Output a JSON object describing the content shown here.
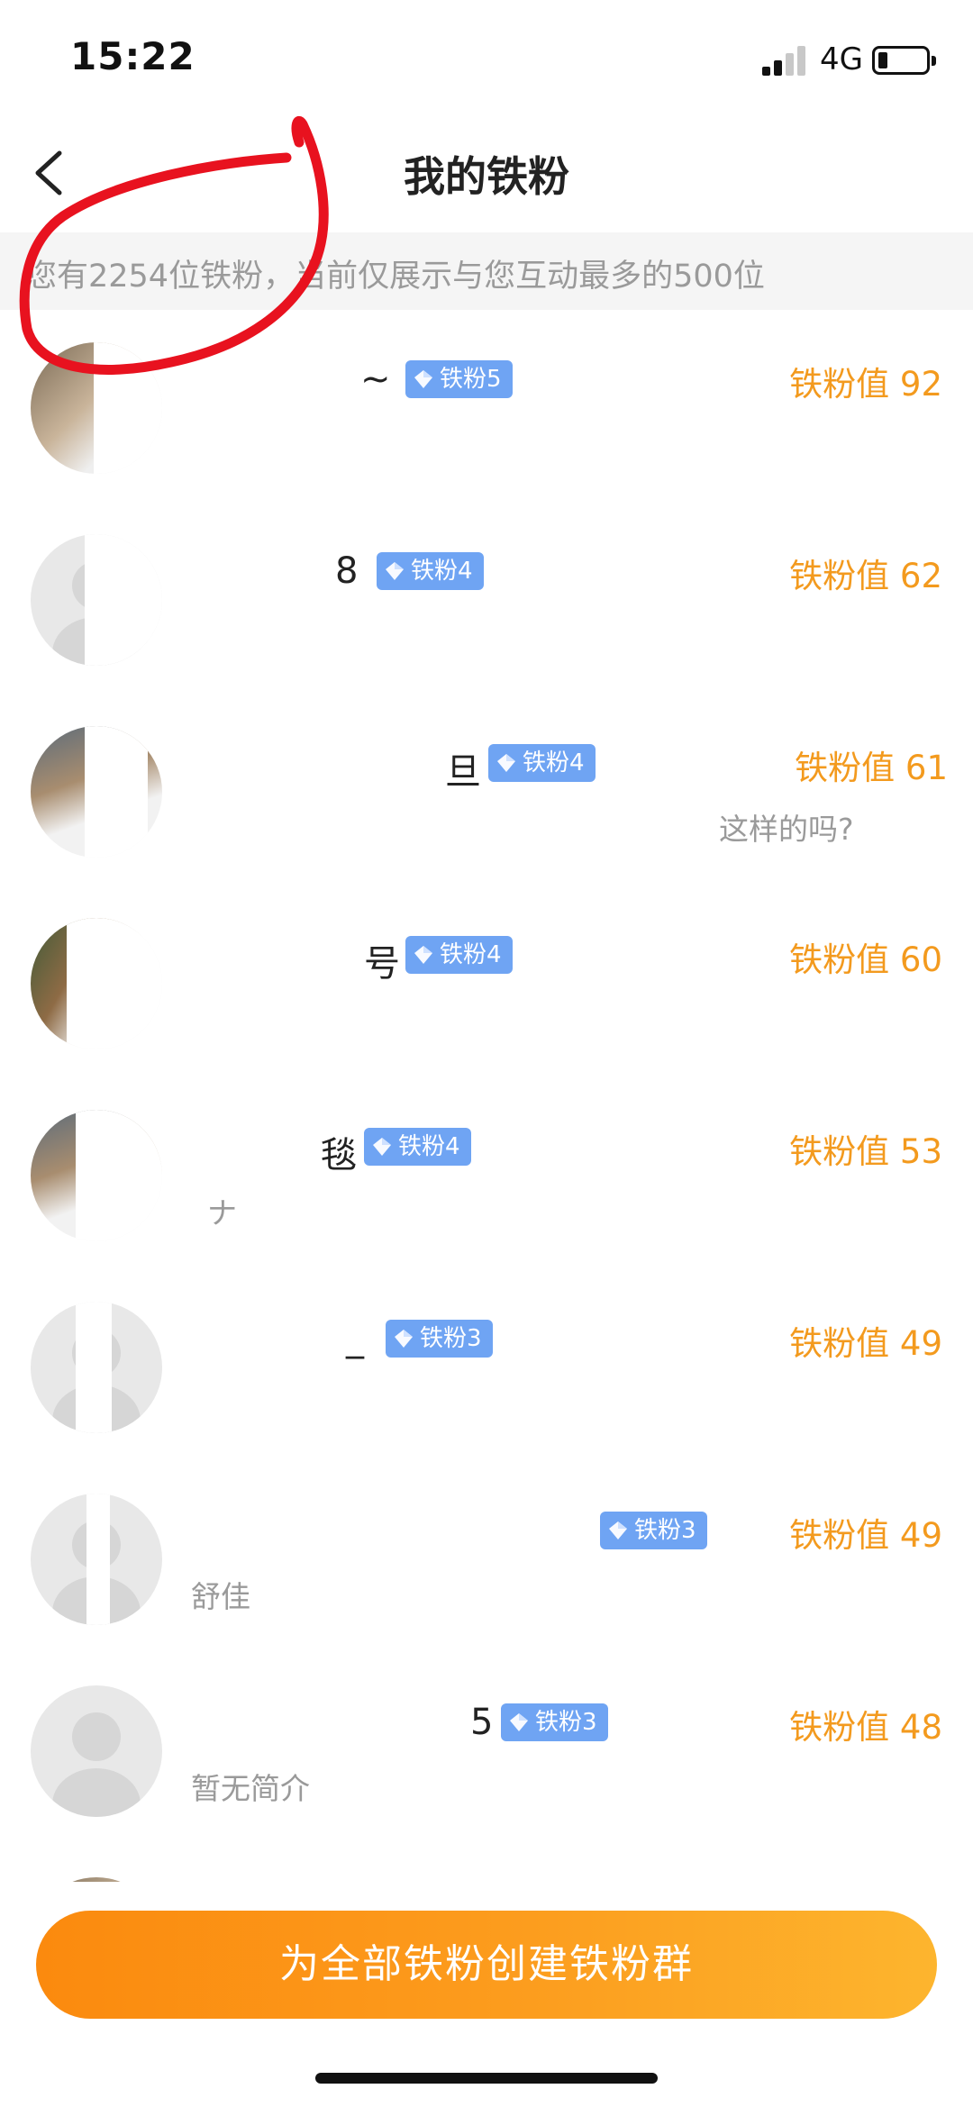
{
  "status_bar": {
    "time": "15:22",
    "network": "4G"
  },
  "nav": {
    "title": "我的铁粉",
    "back_icon": "chevron-left-icon"
  },
  "info": {
    "text": "您有2254位铁粉，当前仅展示与您互动最多的500位"
  },
  "fans": [
    {
      "name_fragment": "~ ",
      "badge": "铁粉5",
      "value": "铁粉值 92",
      "bio": ""
    },
    {
      "name_fragment": "8",
      "badge": "铁粉4",
      "value": "铁粉值 62",
      "bio": ""
    },
    {
      "name_fragment": "旦",
      "badge": "铁粉4",
      "value": "铁粉值 61",
      "bio": "这样的吗?"
    },
    {
      "name_fragment": "号",
      "badge": "铁粉4",
      "value": "铁粉值 60",
      "bio": ""
    },
    {
      "name_fragment": "毯",
      "badge": "铁粉4",
      "value": "铁粉值 53",
      "bio": "ナ"
    },
    {
      "name_fragment": "_",
      "badge": "铁粉3",
      "value": "铁粉值 49",
      "bio": ""
    },
    {
      "name_fragment": "",
      "badge": "铁粉3",
      "value": "铁粉值 49",
      "bio": "舒佳"
    },
    {
      "name_fragment": "5",
      "badge": "铁粉3",
      "value": "铁粉值 48",
      "bio": "暂无简介"
    }
  ],
  "bottom": {
    "create_group_label": "为全部铁粉创建铁粉群"
  },
  "colors": {
    "accent_orange": "#f39a1e",
    "badge_blue": "#6fa4f3",
    "annotation_red": "#e8121f"
  }
}
